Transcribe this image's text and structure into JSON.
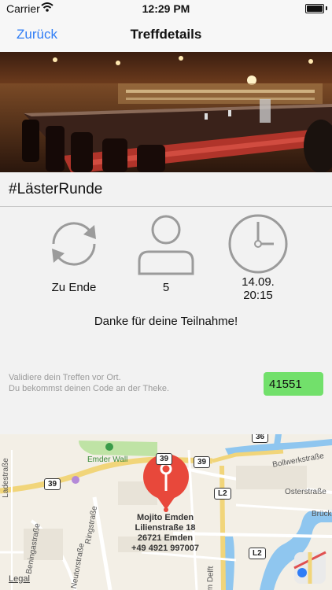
{
  "status_bar": {
    "carrier": "Carrier",
    "time": "12:29 PM"
  },
  "nav": {
    "back_label": "Zurück",
    "title": "Treffdetails"
  },
  "event": {
    "hashtag": "#LästerRunde",
    "status_label": "Zu Ende",
    "participants": "5",
    "date": "14.09.",
    "time": "20:15",
    "thanks_message": "Danke für deine Teilnahme!"
  },
  "validation": {
    "line1": "Validiere dein Treffen vor Ort.",
    "line2": "Du bekommst deinen Code an der Theke.",
    "code": "41551"
  },
  "map": {
    "venue_name": "Mojito Emden",
    "venue_street": "Lilienstraße 18",
    "venue_city": "26721 Emden",
    "venue_phone": "+49 4921 997007",
    "legal": "Legal",
    "labels": {
      "emder_wall": "Emder Wall",
      "ringstrasse": "Ringstraße",
      "bollwerkstrasse": "Bollwerkstraße",
      "osterstrasse": "Osterstraße",
      "brueckstr": "Brückst",
      "ladestrasse": "Ladestraße",
      "beningastrasse": "Beningastraße",
      "neutorstrasse": "Neutorstraße",
      "am_delft": "m Delft"
    },
    "shields": {
      "r39": "39",
      "l2": "L2",
      "r36": "36"
    }
  },
  "colors": {
    "accent": "#2f7df6",
    "code_bg": "#72e06b",
    "pin": "#e8483b"
  }
}
